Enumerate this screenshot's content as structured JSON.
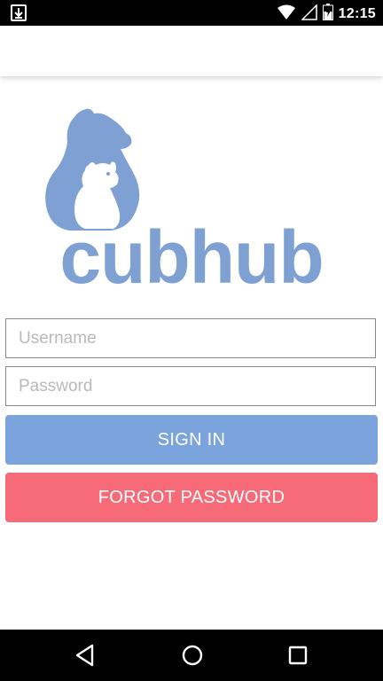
{
  "status_bar": {
    "time": "12:15",
    "icons": [
      "download-icon",
      "wifi-icon",
      "signal-icon",
      "battery-icon"
    ]
  },
  "app": {
    "logo_text": "cubhub",
    "brand_color": "#7ea0d2"
  },
  "login_form": {
    "username_placeholder": "Username",
    "username_value": "",
    "password_placeholder": "Password",
    "password_value": ""
  },
  "buttons": {
    "sign_in_label": "SIGN IN",
    "sign_in_color": "#7ba3dc",
    "forgot_password_label": "FORGOT PASSWORD",
    "forgot_password_color": "#f76a77"
  },
  "nav_bar": {
    "icons": [
      "back-icon",
      "home-icon",
      "recents-icon"
    ]
  }
}
